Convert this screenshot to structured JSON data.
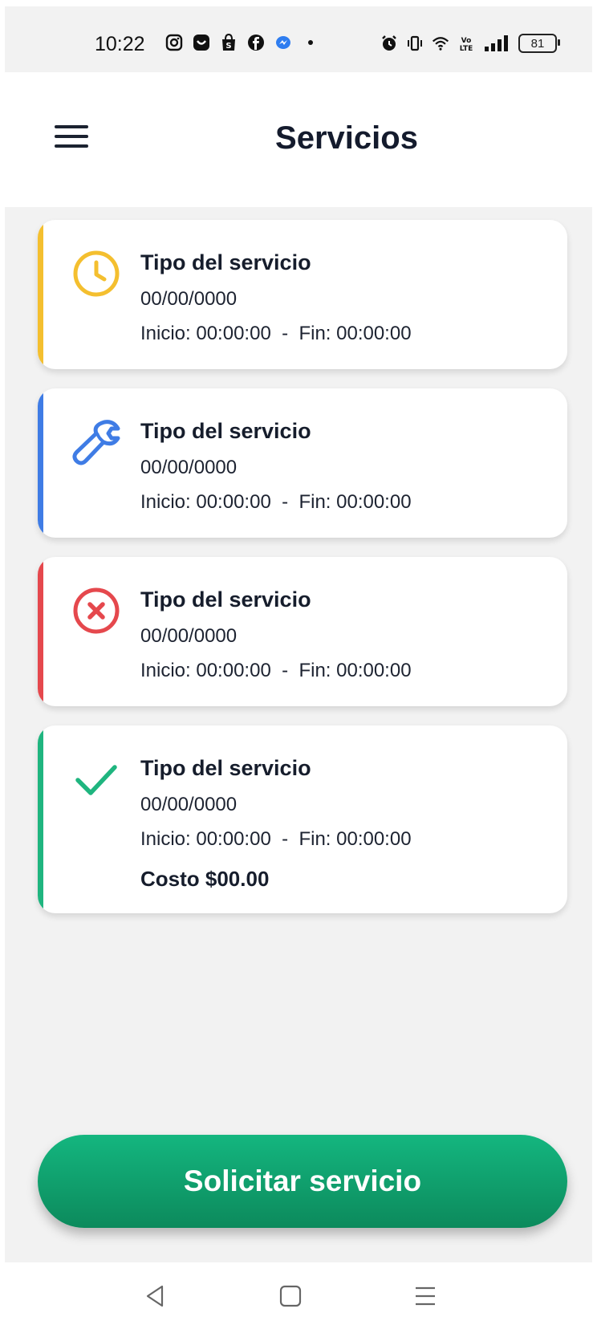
{
  "status_bar": {
    "time": "10:22",
    "battery": "81",
    "left_icons": [
      "instagram-icon",
      "shop-bag-icon",
      "shopee-icon",
      "facebook-icon",
      "messenger-icon",
      "dot-icon"
    ],
    "right_icons": [
      "alarm-icon",
      "vibrate-icon",
      "wifi-icon",
      "volte-icon",
      "signal-icon"
    ]
  },
  "header": {
    "title": "Servicios",
    "menu_icon": "hamburger-menu-icon"
  },
  "services": [
    {
      "status": "pending",
      "icon": "clock-icon",
      "color": "#f4bf2f",
      "title": "Tipo del servicio",
      "date": "00/00/0000",
      "times": "Inicio: 00:00:00  -  Fin: 00:00:00"
    },
    {
      "status": "in-progress",
      "icon": "wrench-icon",
      "color": "#3f7ce5",
      "title": "Tipo del servicio",
      "date": "00/00/0000",
      "times": "Inicio: 00:00:00  -  Fin: 00:00:00"
    },
    {
      "status": "cancelled",
      "icon": "x-circle-icon",
      "color": "#e5484d",
      "title": "Tipo del servicio",
      "date": "00/00/0000",
      "times": "Inicio: 00:00:00  -  Fin: 00:00:00"
    },
    {
      "status": "completed",
      "icon": "checkmark-icon",
      "color": "#1fb57f",
      "title": "Tipo del servicio",
      "date": "00/00/0000",
      "times": "Inicio: 00:00:00  -  Fin: 00:00:00",
      "cost": "Costo $00.00"
    }
  ],
  "cta": {
    "label": "Solicitar servicio"
  },
  "nav": {
    "back_icon": "back-triangle-icon",
    "home_icon": "home-square-icon",
    "recents_icon": "recents-menu-icon"
  }
}
